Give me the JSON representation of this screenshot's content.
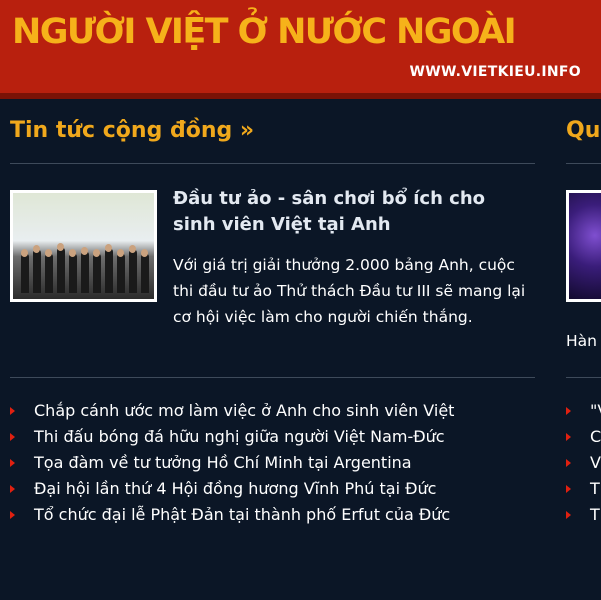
{
  "header": {
    "title": "NGƯỜI VIỆT Ở NƯỚC NGOÀI",
    "url": "WWW.VIETKIEU.INFO",
    "background_color": "#b8200e",
    "title_color": "#f6b21a"
  },
  "left_section": {
    "title": "Tin tức cộng đồng »",
    "featured": {
      "title": "Đầu tư ảo - sân chơi bổ ích cho sinh viên Việt tại Anh",
      "summary": "Với giá trị giải thưởng 2.000 bảng Anh, cuộc thi đầu tư ảo Thử thách Đầu tư III sẽ mang lại cơ hội việc làm cho người chiến thắng.",
      "image_icon": "group-photo-thumbnail"
    },
    "links": [
      "Chắp cánh ước mơ làm việc ở Anh cho sinh viên Việt",
      "Thi đấu bóng đá hữu nghị giữa người Việt Nam-Đức",
      "Tọa đàm về tư tưởng Hồ Chí Minh tại Argentina",
      "Đại hội lần thứ 4 Hội đồng hương Vĩnh Phú tại Đức",
      "Tổ chức đại lễ Phật Đản tại thành phố Erfut của Đức"
    ]
  },
  "right_section": {
    "title": "Qu",
    "summary_fragment": "Hàn",
    "links": [
      "\"V",
      "C",
      "V",
      "T",
      "T"
    ]
  },
  "colors": {
    "page_background": "#0b1626",
    "section_title": "#f0a81c",
    "bullet": "#e02010"
  }
}
